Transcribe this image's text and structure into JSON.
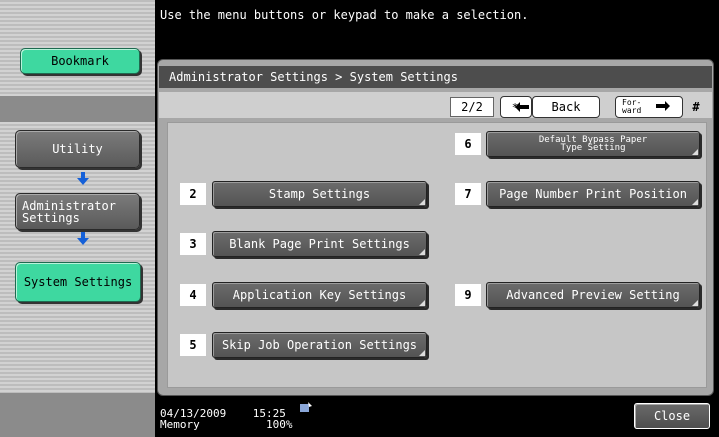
{
  "header": {
    "message": "Use the menu buttons or keypad to make a selection."
  },
  "sidebar": {
    "bookmark": "Bookmark",
    "path": [
      {
        "label": "Utility"
      },
      {
        "label": "Administrator Settings"
      },
      {
        "label": "System Settings"
      }
    ]
  },
  "panel": {
    "breadcrumb": "Administrator Settings > System Settings",
    "page_indicator": "2/2",
    "star_label": "*",
    "back_label": "Back",
    "forward_label": "For-ward"
  },
  "menu": [
    {
      "num": "2",
      "label": "Stamp Settings"
    },
    {
      "num": "3",
      "label": "Blank Page Print Settings"
    },
    {
      "num": "4",
      "label": "Application Key Settings"
    },
    {
      "num": "5",
      "label": "Skip Job Operation Settings"
    },
    {
      "num": "6",
      "label": "Default Bypass Paper Type Setting"
    },
    {
      "num": "7",
      "label": "Page Number Print Position"
    },
    {
      "num": "9",
      "label": "Advanced Preview Setting"
    }
  ],
  "status": {
    "date": "04/13/2009",
    "time": "15:25",
    "memory_label": "Memory",
    "memory_value": "100%"
  },
  "close_label": "Close",
  "colors": {
    "accent_green": "#3ed8a0",
    "arrow_blue": "#1560d8"
  },
  "icons": [
    "down-arrow-icon",
    "back-arrow-icon",
    "forward-arrow-icon",
    "hash-icon",
    "network-status-icon"
  ]
}
